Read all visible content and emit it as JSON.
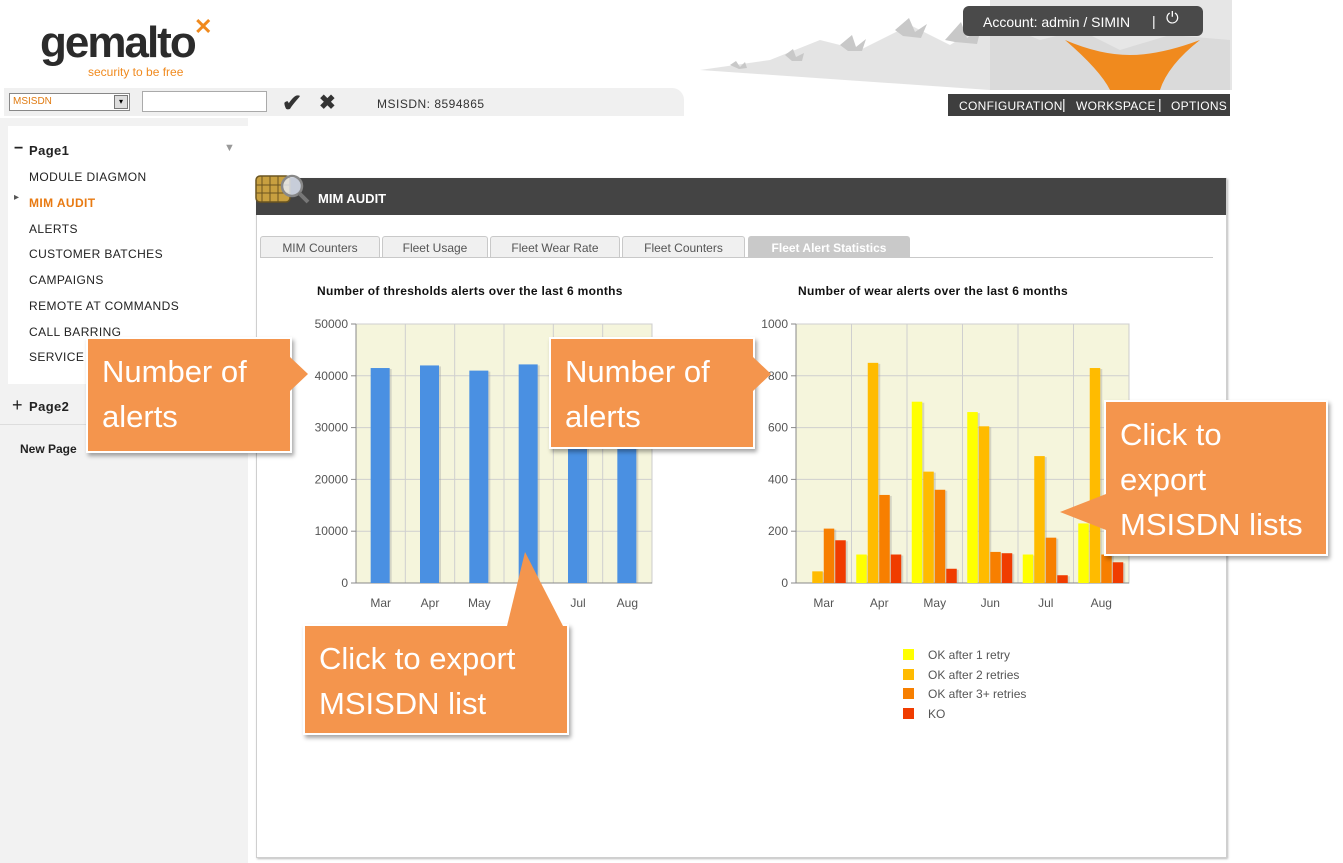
{
  "header": {
    "logo_name": "gemalto",
    "logo_mark": "✕",
    "logo_tagline": "security to be free",
    "account_label": "Account: admin / SIMIN",
    "power_icon": "⏻",
    "nav": [
      "CONFIGURATION",
      "WORKSPACE",
      "OPTIONS"
    ]
  },
  "toolbar": {
    "select_value": "MSISDN",
    "select_arrow": "▾",
    "input_value": "",
    "confirm_icon": "✔",
    "clear_icon": "✖",
    "msisdn_display": "MSISDN: 8594865"
  },
  "sidebar": {
    "page1": {
      "toggle": "−",
      "label": "Page1",
      "collapse_icon": "▼"
    },
    "items": [
      "MODULE DIAGMON",
      "MIM AUDIT",
      "ALERTS",
      "CUSTOMER BATCHES",
      "CAMPAIGNS",
      "REMOTE AT COMMANDS",
      "CALL BARRING",
      "SERVICE"
    ],
    "active_marker": "▸",
    "page2": {
      "toggle": "+",
      "label": "Page2"
    },
    "new_page": "New Page"
  },
  "panel": {
    "title": "MIM AUDIT",
    "tabs": [
      "MIM Counters",
      "Fleet Usage",
      "Fleet Wear Rate",
      "Fleet Counters",
      "Fleet Alert Statistics"
    ],
    "active_tab": "Fleet Alert Statistics"
  },
  "chart_data": [
    {
      "type": "bar",
      "title": "Number of thresholds alerts over the last 6 months",
      "categories": [
        "Mar",
        "Apr",
        "May",
        "Jun",
        "Jul",
        "Aug"
      ],
      "values": [
        41500,
        42000,
        41000,
        42200,
        41500,
        41500
      ],
      "ylim": [
        0,
        50000
      ],
      "yticks": [
        0,
        10000,
        20000,
        30000,
        40000,
        50000
      ],
      "color": "#4a90e2",
      "grid": true
    },
    {
      "type": "bar",
      "title": "Number of wear alerts over the last 6 months",
      "categories": [
        "Mar",
        "Apr",
        "May",
        "Jun",
        "Jul",
        "Aug"
      ],
      "ylim": [
        0,
        1000
      ],
      "yticks": [
        0,
        200,
        400,
        600,
        800,
        1000
      ],
      "ytick_labels": [
        "0",
        "200",
        "400",
        "600",
        "800",
        "1000"
      ],
      "grid": true,
      "legend_position": "bottom",
      "series": [
        {
          "name": "OK after 1 retry",
          "color": "#ffff00",
          "values": [
            0,
            110,
            700,
            660,
            110,
            230
          ]
        },
        {
          "name": "OK after 2 retries",
          "color": "#ffbb00",
          "values": [
            45,
            850,
            430,
            605,
            490,
            830
          ]
        },
        {
          "name": "OK after 3+ retries",
          "color": "#f77f00",
          "values": [
            210,
            340,
            360,
            120,
            175,
            110
          ]
        },
        {
          "name": "KO",
          "color": "#f03c00",
          "values": [
            165,
            110,
            55,
            115,
            30,
            80
          ]
        }
      ]
    }
  ],
  "callouts": {
    "left_alerts": "Number of alerts",
    "right_alerts": "Number of alerts",
    "export_list": "Click to export MSISDN list",
    "export_lists": "Click to export MSISDN lists"
  }
}
